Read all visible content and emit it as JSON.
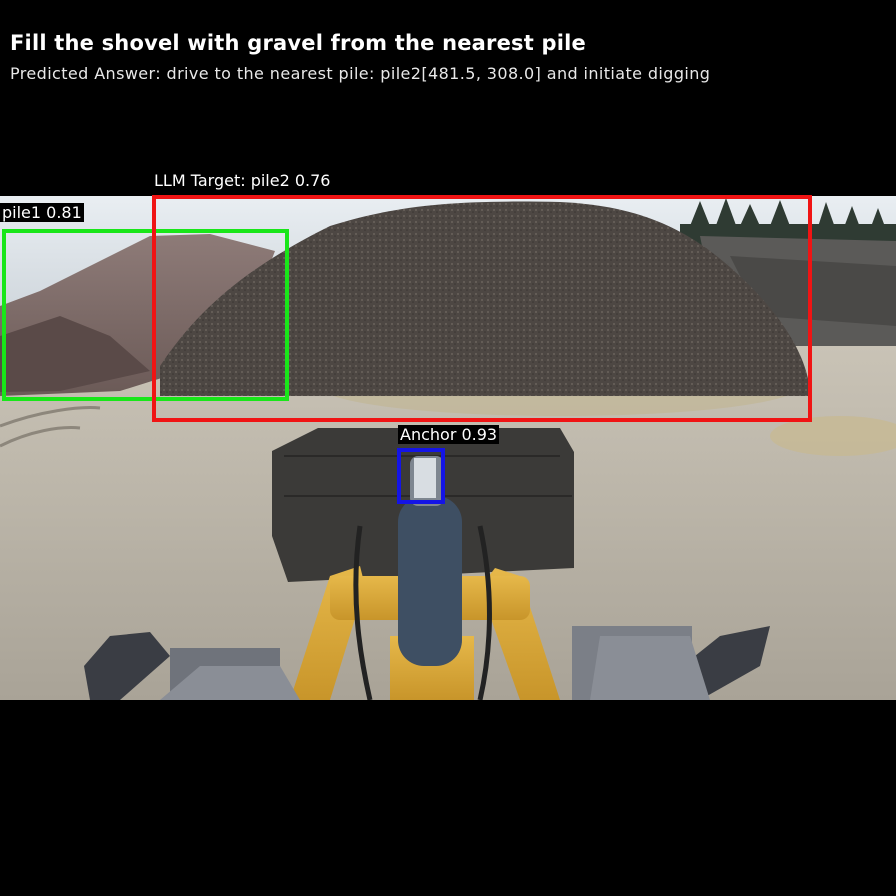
{
  "header": {
    "title": "Fill the shovel with gravel from the nearest pile",
    "prediction": "Predicted Answer: drive to the nearest pile: pile2[481.5, 308.0] and initiate digging"
  },
  "detections": [
    {
      "id": "pile1",
      "label": "pile1 0.81",
      "color": "#19e619"
    },
    {
      "id": "pile2",
      "label": "LLM Target: pile2 0.76",
      "color": "#f01414"
    },
    {
      "id": "anchor",
      "label": "Anchor 0.93",
      "color": "#1414e6"
    }
  ],
  "scene": {
    "description_icon": "wheel-loader-camera-view"
  }
}
